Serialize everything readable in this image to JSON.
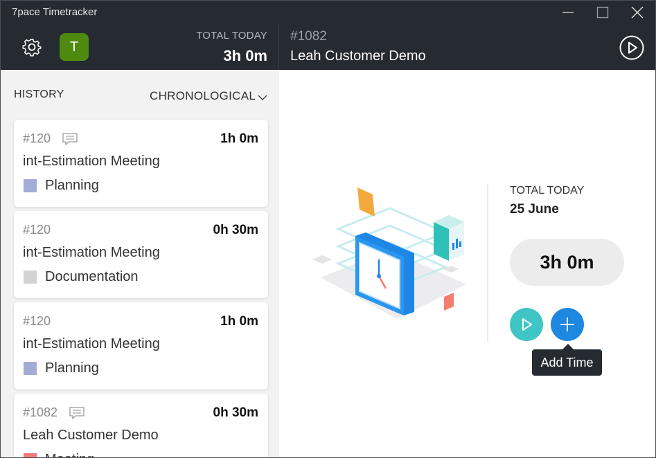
{
  "window": {
    "title": "7pace Timetracker"
  },
  "header": {
    "avatar_initial": "T",
    "total_today_label": "TOTAL TODAY",
    "total_today_value": "3h 0m",
    "current_item_id": "#1082",
    "current_item_title": "Leah Customer Demo"
  },
  "history": {
    "label": "HISTORY",
    "sort_label": "CHRONOLOGICAL",
    "items": [
      {
        "id": "#120",
        "has_comment": true,
        "duration": "1h 0m",
        "title": "int-Estimation Meeting",
        "tag": "Planning",
        "tag_color": "#a2acd6"
      },
      {
        "id": "#120",
        "has_comment": false,
        "duration": "0h 30m",
        "title": "int-Estimation Meeting",
        "tag": "Documentation",
        "tag_color": "#d3d3d3"
      },
      {
        "id": "#120",
        "has_comment": false,
        "duration": "1h 0m",
        "title": "int-Estimation Meeting",
        "tag": "Planning",
        "tag_color": "#a2acd6"
      },
      {
        "id": "#1082",
        "has_comment": true,
        "duration": "0h 30m",
        "title": "Leah Customer Demo",
        "tag": "Meeting",
        "tag_color": "#f27b7b"
      }
    ]
  },
  "summary": {
    "total_today_label": "TOTAL TODAY",
    "date": "25 June",
    "total_value": "3h 0m",
    "add_time_tooltip": "Add Time"
  },
  "colors": {
    "header_bg": "#262a31",
    "play_button": "#3fc6c4",
    "add_button": "#1e87e0",
    "avatar": "#4f8a10"
  }
}
